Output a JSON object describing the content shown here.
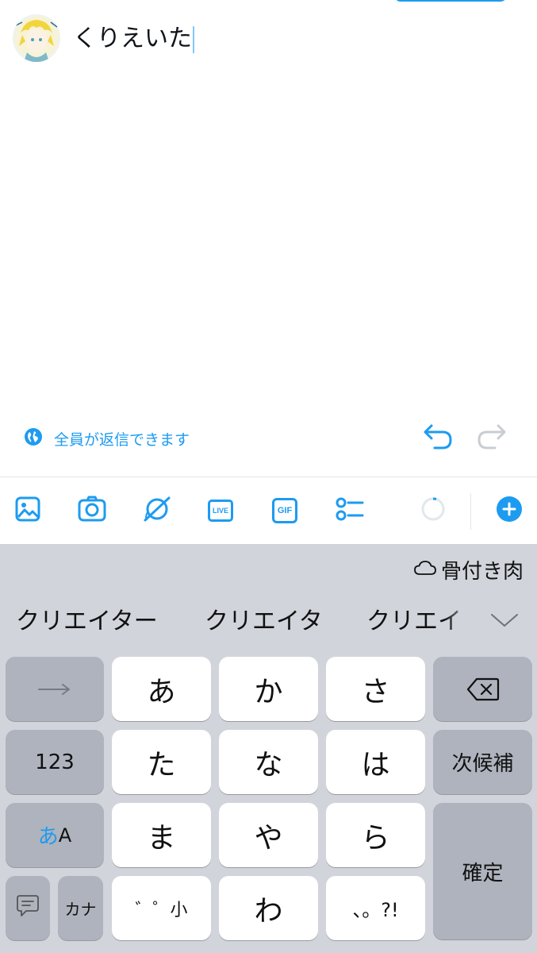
{
  "compose": {
    "text": "くりえいた",
    "reply_setting": "全員が返信できます"
  },
  "toolbar": {
    "live_label": "LIVE",
    "gif_label": "GIF"
  },
  "keyboard": {
    "cloud_suggestion": "骨付き肉",
    "candidates": [
      "クリエイター",
      "クリエイタ",
      "クリエイ"
    ],
    "rows": [
      [
        "→",
        "あ",
        "か",
        "さ",
        "⌫"
      ],
      [
        "123",
        "た",
        "な",
        "は",
        "次候補"
      ],
      [
        "あA",
        "ま",
        "や",
        "ら",
        "確定"
      ],
      [
        "",
        "カナ",
        "゛゜小",
        "わ",
        "、。?!"
      ]
    ],
    "mode_kana": "あ",
    "mode_latin": "A"
  },
  "colors": {
    "accent": "#1d9bf0",
    "keyboard_bg": "#d1d4da",
    "key_white": "#ffffff",
    "key_gray": "#aeb3bd"
  }
}
